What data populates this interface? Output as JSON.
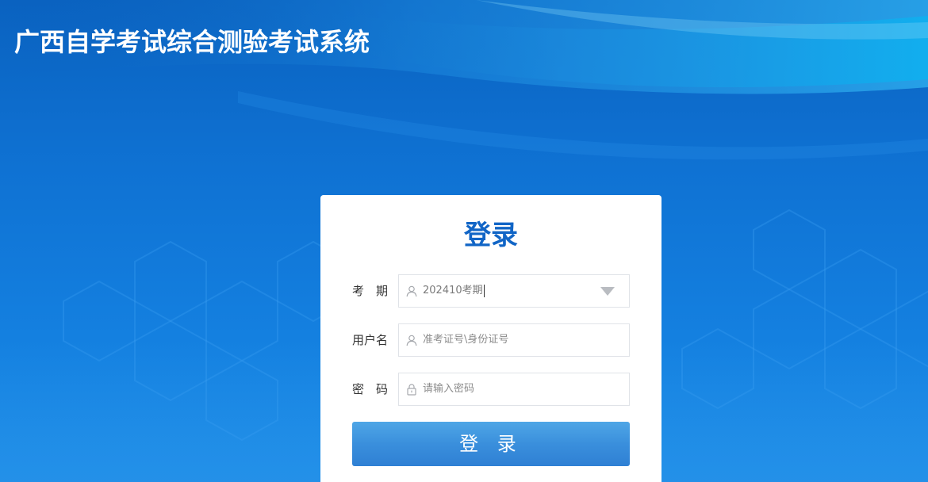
{
  "header": {
    "title": "广西自学考试综合测验考试系统"
  },
  "login": {
    "heading": "登录",
    "fields": {
      "period": {
        "label": "考　期",
        "value": "202410考期"
      },
      "username": {
        "label": "用户名",
        "placeholder": "准考证号\\身份证号"
      },
      "password": {
        "label": "密　码",
        "placeholder": "请输入密码"
      }
    },
    "submit_label": "登 录"
  },
  "colors": {
    "background": "#0f72d3",
    "heading": "#1165c6",
    "button": "#3a8fdc",
    "card": "#ffffff"
  },
  "icons": {
    "period": "user-icon",
    "username": "user-icon",
    "password": "lock-icon",
    "period_dropdown": "dropdown-triangle-icon"
  }
}
